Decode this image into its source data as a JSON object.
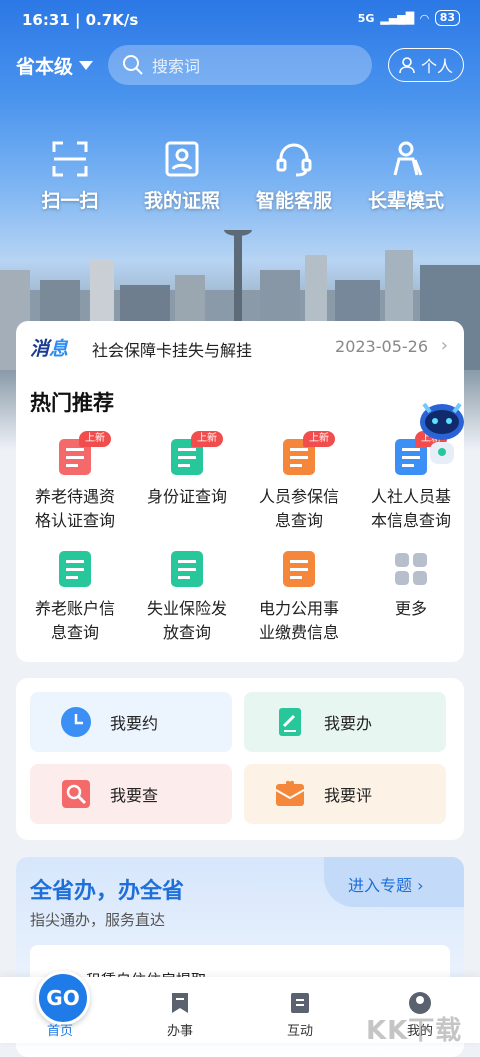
{
  "status_bar": {
    "time": "16:31 | 0.7K/s",
    "signal": "5G",
    "battery": "83"
  },
  "header": {
    "region": "省本级",
    "search_placeholder": "搜索词",
    "personal_label": "个人"
  },
  "quick_actions": [
    {
      "label": "扫一扫",
      "icon": "scan-icon"
    },
    {
      "label": "我的证照",
      "icon": "id-card-icon"
    },
    {
      "label": "智能客服",
      "icon": "headset-icon"
    },
    {
      "label": "长辈模式",
      "icon": "elder-icon"
    }
  ],
  "message": {
    "tag_a": "消",
    "tag_b": "息",
    "text": "社会保障卡挂失与解挂",
    "date": "2023-05-26"
  },
  "hot": {
    "title": "热门推荐",
    "items": [
      {
        "label": "养老待遇资格认证查询",
        "badge": "上新",
        "color": "#f46a6a"
      },
      {
        "label": "身份证查询",
        "badge": "上新",
        "color": "#28c79b"
      },
      {
        "label": "人员参保信息查询",
        "badge": "上新",
        "color": "#f5873b"
      },
      {
        "label": "人社人员基本信息查询",
        "badge": "上新",
        "color": "#3b8ff5"
      },
      {
        "label": "养老账户信息查询",
        "badge": "",
        "color": "#28c79b"
      },
      {
        "label": "失业保险发放查询",
        "badge": "",
        "color": "#28c79b"
      },
      {
        "label": "电力公用事业缴费信息",
        "badge": "",
        "color": "#f5873b"
      },
      {
        "label": "更多",
        "badge": "",
        "color": "#b8bfcc"
      }
    ]
  },
  "actions": [
    {
      "label": "我要约",
      "bg": "#ecf4fe",
      "color": "#3b8ff5"
    },
    {
      "label": "我要办",
      "bg": "#e8f6f1",
      "color": "#28c79b"
    },
    {
      "label": "我要查",
      "bg": "#fdecec",
      "color": "#f46a6a"
    },
    {
      "label": "我要评",
      "bg": "#fdf2e6",
      "color": "#f5873b"
    }
  ],
  "province": {
    "title": "全省办，办全省",
    "subtitle": "指尖通办，服务直达",
    "enter": "进入专题",
    "partial_item": "租赁自住住房提取"
  },
  "tabbar": [
    {
      "label": "首页",
      "active": true
    },
    {
      "label": "办事",
      "active": false
    },
    {
      "label": "互动",
      "active": false
    },
    {
      "label": "我的",
      "active": false
    }
  ],
  "home_logo": "GO",
  "watermark": "KK下载"
}
